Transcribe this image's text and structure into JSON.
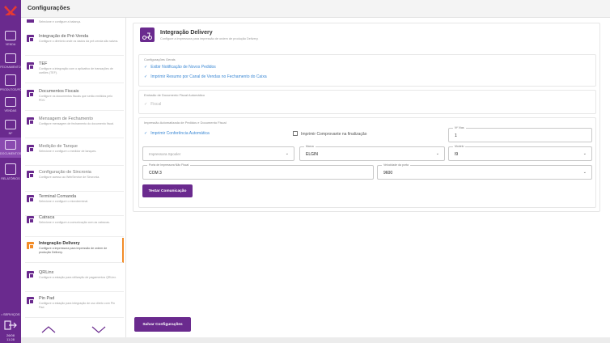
{
  "app": {
    "header_title": "Configurações"
  },
  "rail": {
    "items": [
      {
        "icon": "cart-icon",
        "label": "VENDA"
      },
      {
        "icon": "calculator-icon",
        "label": "FECHAMENTO"
      },
      {
        "icon": "products-icon",
        "label": "PRODUTOS/PDV"
      },
      {
        "icon": "sales-icon",
        "label": "VENDAS"
      },
      {
        "icon": "nf-icon",
        "label": "NF"
      },
      {
        "icon": "documents-icon",
        "label": "DOCUMENTOS"
      },
      {
        "icon": "reports-icon",
        "label": "RELATÓRIOS"
      }
    ],
    "bottom_label": "• SERVIÇOS",
    "clock_date": "26/08",
    "clock_time": "11:28"
  },
  "list": {
    "partial_desc": "Selecione e configure a balança.",
    "items": [
      {
        "title": "Integração de Pré-Venda",
        "desc": "Configure o diretório onde os dados da pré-venda são salvos."
      },
      {
        "title": "TEF",
        "desc": "Configure a integração com o aplicativo de transações de cartões (TEF)."
      },
      {
        "title": "Documentos Fiscais",
        "desc": "Configure os documentos fiscais que serão emitidos pelo PDV."
      },
      {
        "title": "Mensagem de Fechamento",
        "desc": "Configure mensagem de fechamento do documento fiscal."
      },
      {
        "title": "Medição de Tanque",
        "desc": "Selecione e configure o medidor de tanques."
      },
      {
        "title": "Configuração de Sincronia",
        "desc": "Configure acesso ao WebService de Sincronia."
      },
      {
        "title": "Terminal Comanda",
        "desc": "Selecione e configure o microterminal."
      },
      {
        "title": "Catraca",
        "desc": "Selecione e configure a comunicação com as catracas."
      },
      {
        "title": "Integração Delivery",
        "desc": "Configure a impressora para impressão de ordem de produção Delivery."
      },
      {
        "title": "QRLinx",
        "desc": "Configure a estação para utilização de pagamentos QRLinx."
      },
      {
        "title": "Pin Pad",
        "desc": "Configure a estação para integração de uso direto com Pin Pad."
      }
    ]
  },
  "main": {
    "title": "Integração Delivery",
    "subtitle": "Configure a impressora para impressão de ordem de produção Delivery.",
    "general": {
      "title": "Configurações Gerais",
      "opt1": "Exibir Notificação de Novos Pedidos",
      "opt2": "Imprimir Resumo por Canal de Vendas no Fechamento do Caixa"
    },
    "fiscal": {
      "title": "Emissão de Documento Fiscal Automático",
      "opt1": "Fiscal"
    },
    "print": {
      "title": "Impressão Automatizada de Pedidos e Documento Fiscal",
      "opt_conference": "Imprimir Conferência Automática",
      "opt_receipt": "Imprimir Comprovante na finalização",
      "copies_label": "Nº Vias",
      "copies_value": "1",
      "spooler_placeholder": "Impressora Spooler",
      "brand_label": "Marca",
      "brand_value": "ELGIN",
      "model_label": "Modelo",
      "model_value": "I9",
      "port_label": "Porta de Impressora Não Fiscal",
      "port_value": "COM 3",
      "speed_label": "Velocidade da porta",
      "speed_value": "9600",
      "test_button": "Testar Comunicação"
    },
    "save_button": "Salvar Configurações"
  },
  "colors": {
    "brand": "#6a2a8e",
    "accent": "#f28c28",
    "link": "#3b88d4"
  }
}
